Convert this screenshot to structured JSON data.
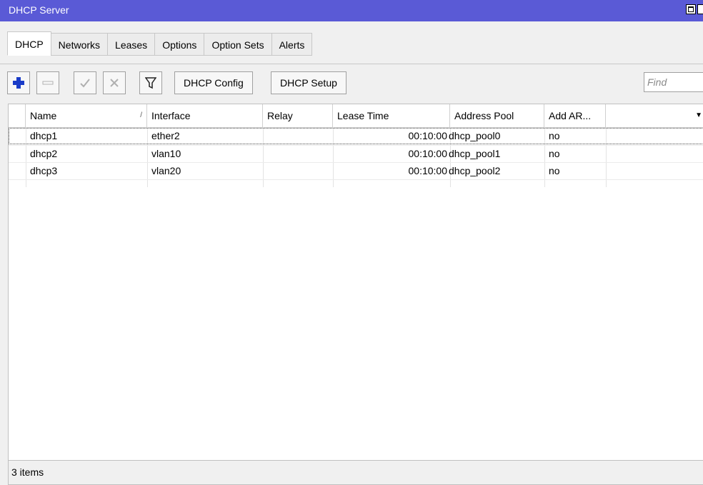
{
  "window": {
    "title": "DHCP Server"
  },
  "tabs": [
    {
      "label": "DHCP",
      "active": true
    },
    {
      "label": "Networks"
    },
    {
      "label": "Leases"
    },
    {
      "label": "Options"
    },
    {
      "label": "Option Sets"
    },
    {
      "label": "Alerts"
    }
  ],
  "toolbar": {
    "add_icon": "plus-icon",
    "remove_icon": "minus-icon",
    "enable_icon": "check-icon",
    "disable_icon": "x-icon",
    "filter_icon": "filter-icon",
    "dhcp_config_label": "DHCP Config",
    "dhcp_setup_label": "DHCP Setup",
    "find_placeholder": "Find"
  },
  "table": {
    "columns": [
      "Name",
      "Interface",
      "Relay",
      "Lease Time",
      "Address Pool",
      "Add AR..."
    ],
    "sort_indicator": "/",
    "rows": [
      {
        "name": "dhcp1",
        "interface": "ether2",
        "relay": "",
        "lease_time": "00:10:00",
        "address_pool": "dhcp_pool0",
        "add_arp": "no"
      },
      {
        "name": "dhcp2",
        "interface": "vlan10",
        "relay": "",
        "lease_time": "00:10:00",
        "address_pool": "dhcp_pool1",
        "add_arp": "no"
      },
      {
        "name": "dhcp3",
        "interface": "vlan20",
        "relay": "",
        "lease_time": "00:10:00",
        "address_pool": "dhcp_pool2",
        "add_arp": "no"
      }
    ]
  },
  "status": {
    "count_text": "3 items"
  },
  "colors": {
    "titlebar": "#5a5ad6",
    "add_icon": "#1a3cc8"
  }
}
